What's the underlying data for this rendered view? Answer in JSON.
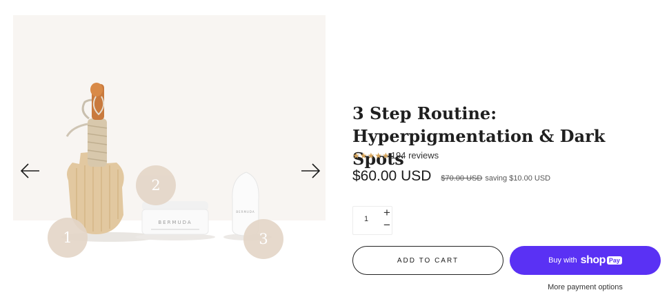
{
  "gallery": {
    "step_badges": [
      "1",
      "2",
      "3"
    ],
    "jar_brand": "BERMUDA",
    "bottle_brand": "BERMUDA",
    "icons": [
      "arrow-left-icon",
      "arrow-right-icon"
    ]
  },
  "product": {
    "title": "3 Step Routine: Hyperpigmentation & Dark Spots",
    "rating": {
      "stars": "★★★★★",
      "stars_value": 5,
      "reviews_label": "194 reviews"
    },
    "price": "$60.00 USD",
    "compare_at_price": "$70.00 USD",
    "saving_label": "saving $10.00 USD",
    "quantity": {
      "value": "1",
      "plus_symbol": "+",
      "minus_symbol": "−"
    },
    "add_to_cart_label": "ADD TO CART",
    "shop_pay": {
      "prefix": "Buy with",
      "wordmark": "shop",
      "pill": "Pay"
    },
    "more_payment_label": "More payment options"
  },
  "colors": {
    "star": "#d4a35a",
    "shop_pay": "#5a31f4",
    "badge": "#e4d6c8",
    "gallery_bg": "#f8f5f2"
  }
}
